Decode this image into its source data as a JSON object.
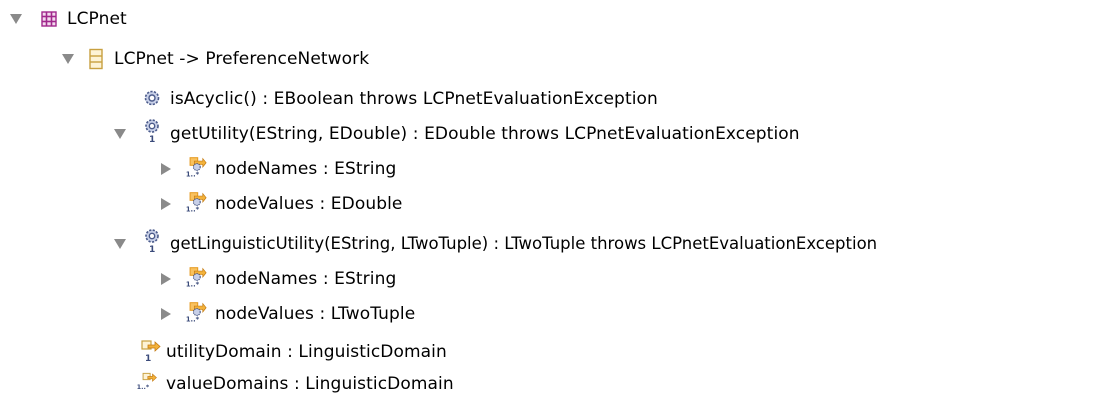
{
  "tree": {
    "rows": [
      {
        "label": "LCPnet",
        "icon": "package-icon",
        "toggle": "expanded"
      },
      {
        "label": "LCPnet -> PreferenceNetwork",
        "icon": "class-icon",
        "toggle": "expanded"
      },
      {
        "label": "isAcyclic() : EBoolean throws LCPnetEvaluationException",
        "icon": "operation-icon",
        "toggle": "none"
      },
      {
        "label": "getUtility(EString, EDouble) : EDouble throws LCPnetEvaluationException",
        "icon": "operation-single-icon",
        "toggle": "expanded"
      },
      {
        "label": "nodeNames : EString",
        "icon": "parameter-many-icon",
        "toggle": "collapsed"
      },
      {
        "label": "nodeValues : EDouble",
        "icon": "parameter-many-icon",
        "toggle": "collapsed"
      },
      {
        "label": "getLinguisticUtility(EString, LTwoTuple) : LTwoTuple throws LCPnetEvaluationException",
        "icon": "operation-single-icon",
        "toggle": "expanded"
      },
      {
        "label": "nodeNames : EString",
        "icon": "parameter-many-icon",
        "toggle": "collapsed"
      },
      {
        "label": "nodeValues : LTwoTuple",
        "icon": "parameter-many-icon",
        "toggle": "collapsed"
      },
      {
        "label": "utilityDomain : LinguisticDomain",
        "icon": "reference-single-icon",
        "toggle": "none"
      },
      {
        "label": "valueDomains : LinguisticDomain",
        "icon": "reference-many-icon",
        "toggle": "none"
      }
    ],
    "multiplicity_single": "1",
    "multiplicity_many": "1..*",
    "colors": {
      "package": "#a0288c",
      "class": "#c8a040",
      "operation": "#4a5a8a",
      "param_orange": "#e59a1e",
      "param_gear": "#3a4a7a",
      "toggle": "#8a8a8a"
    }
  }
}
